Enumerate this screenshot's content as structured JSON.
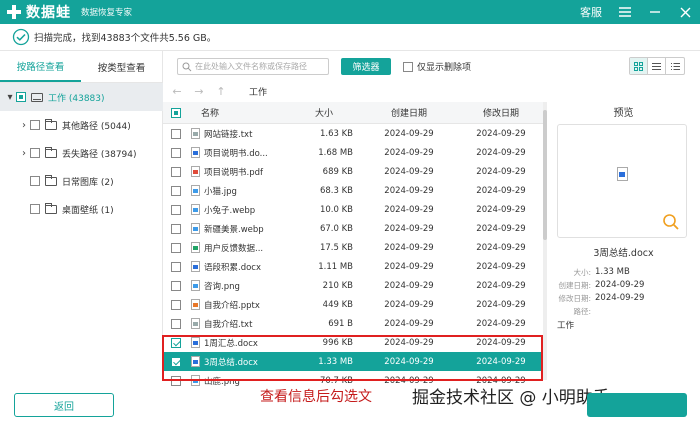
{
  "app": {
    "name": "数据蛙",
    "subtitle": "数据恢复专家",
    "service_label": "客服",
    "brand_color": "#14a39a"
  },
  "status": {
    "text": "扫描完成，找到43883个文件共5.56 GB。"
  },
  "sidebar": {
    "tabs": [
      {
        "label": "按路径查看",
        "active": true
      },
      {
        "label": "按类型查看",
        "active": false
      }
    ],
    "tree": [
      {
        "label": "工作 (43883)",
        "icon": "drive-icon",
        "checked": true
      },
      {
        "label": "其他路径 (5044)",
        "icon": "folder-icon",
        "expandable": true
      },
      {
        "label": "丢失路径 (38794)",
        "icon": "folder-icon",
        "expandable": true
      },
      {
        "label": "日常图库 (2)",
        "icon": "folder-icon"
      },
      {
        "label": "桌面壁纸 (1)",
        "icon": "folder-icon"
      }
    ],
    "back_label": "返回"
  },
  "toolbar": {
    "search_placeholder": "在此处输入文件名称或保存路径",
    "filter_label": "筛选器",
    "deleted_only_label": "仅显示删除项"
  },
  "nav": {
    "path": "工作"
  },
  "table": {
    "headers": {
      "name": "名称",
      "size": "大小",
      "created": "创建日期",
      "modified": "修改日期"
    },
    "rows": [
      {
        "name": "网站链接.txt",
        "size": "1.63 KB",
        "created": "2024-09-29",
        "modified": "2024-09-29",
        "type": "txt",
        "checked": false
      },
      {
        "name": "项目说明书.do...",
        "size": "1.68 MB",
        "created": "2024-09-29",
        "modified": "2024-09-29",
        "type": "docx",
        "checked": false
      },
      {
        "name": "项目说明书.pdf",
        "size": "689 KB",
        "created": "2024-09-29",
        "modified": "2024-09-29",
        "type": "pdf",
        "checked": false
      },
      {
        "name": "小猫.jpg",
        "size": "68.3 KB",
        "created": "2024-09-29",
        "modified": "2024-09-29",
        "type": "img",
        "checked": false
      },
      {
        "name": "小兔子.webp",
        "size": "10.0 KB",
        "created": "2024-09-29",
        "modified": "2024-09-29",
        "type": "img",
        "checked": false
      },
      {
        "name": "新疆美景.webp",
        "size": "67.0 KB",
        "created": "2024-09-29",
        "modified": "2024-09-29",
        "type": "img",
        "checked": false
      },
      {
        "name": "用户反馈数据...",
        "size": "17.5 KB",
        "created": "2024-09-29",
        "modified": "2024-09-29",
        "type": "xlsx",
        "checked": false
      },
      {
        "name": "语段积累.docx",
        "size": "1.11 MB",
        "created": "2024-09-29",
        "modified": "2024-09-29",
        "type": "docx",
        "checked": false
      },
      {
        "name": "咨询.png",
        "size": "210 KB",
        "created": "2024-09-29",
        "modified": "2024-09-29",
        "type": "img",
        "checked": false
      },
      {
        "name": "自我介绍.pptx",
        "size": "449 KB",
        "created": "2024-09-29",
        "modified": "2024-09-29",
        "type": "pptx",
        "checked": false
      },
      {
        "name": "自我介绍.txt",
        "size": "691  B",
        "created": "2024-09-29",
        "modified": "2024-09-29",
        "type": "txt",
        "checked": false
      },
      {
        "name": "1周汇总.docx",
        "size": "996 KB",
        "created": "2024-09-29",
        "modified": "2024-09-29",
        "type": "docx",
        "checked": true
      },
      {
        "name": "3周总结.docx",
        "size": "1.33 MB",
        "created": "2024-09-29",
        "modified": "2024-09-29",
        "type": "docx",
        "checked": true,
        "selected": true
      },
      {
        "name": "山鹿.png",
        "size": "70.7 KB",
        "created": "2024-09-29",
        "modified": "2024-09-29",
        "type": "img",
        "checked": false
      }
    ]
  },
  "preview": {
    "title": "预览",
    "file_name": "3周总结.docx",
    "meta": [
      {
        "label": "大小:",
        "value": "1.33 MB"
      },
      {
        "label": "创建日期:",
        "value": "2024-09-29"
      },
      {
        "label": "修改日期:",
        "value": "2024-09-29"
      },
      {
        "label": "路径:",
        "value": ""
      }
    ],
    "path_value": "工作"
  },
  "overlay": {
    "caption": "查看信息后勾选文",
    "watermark": "掘金技术社区 @ 小明助手",
    "highlight_color": "#e02020"
  }
}
